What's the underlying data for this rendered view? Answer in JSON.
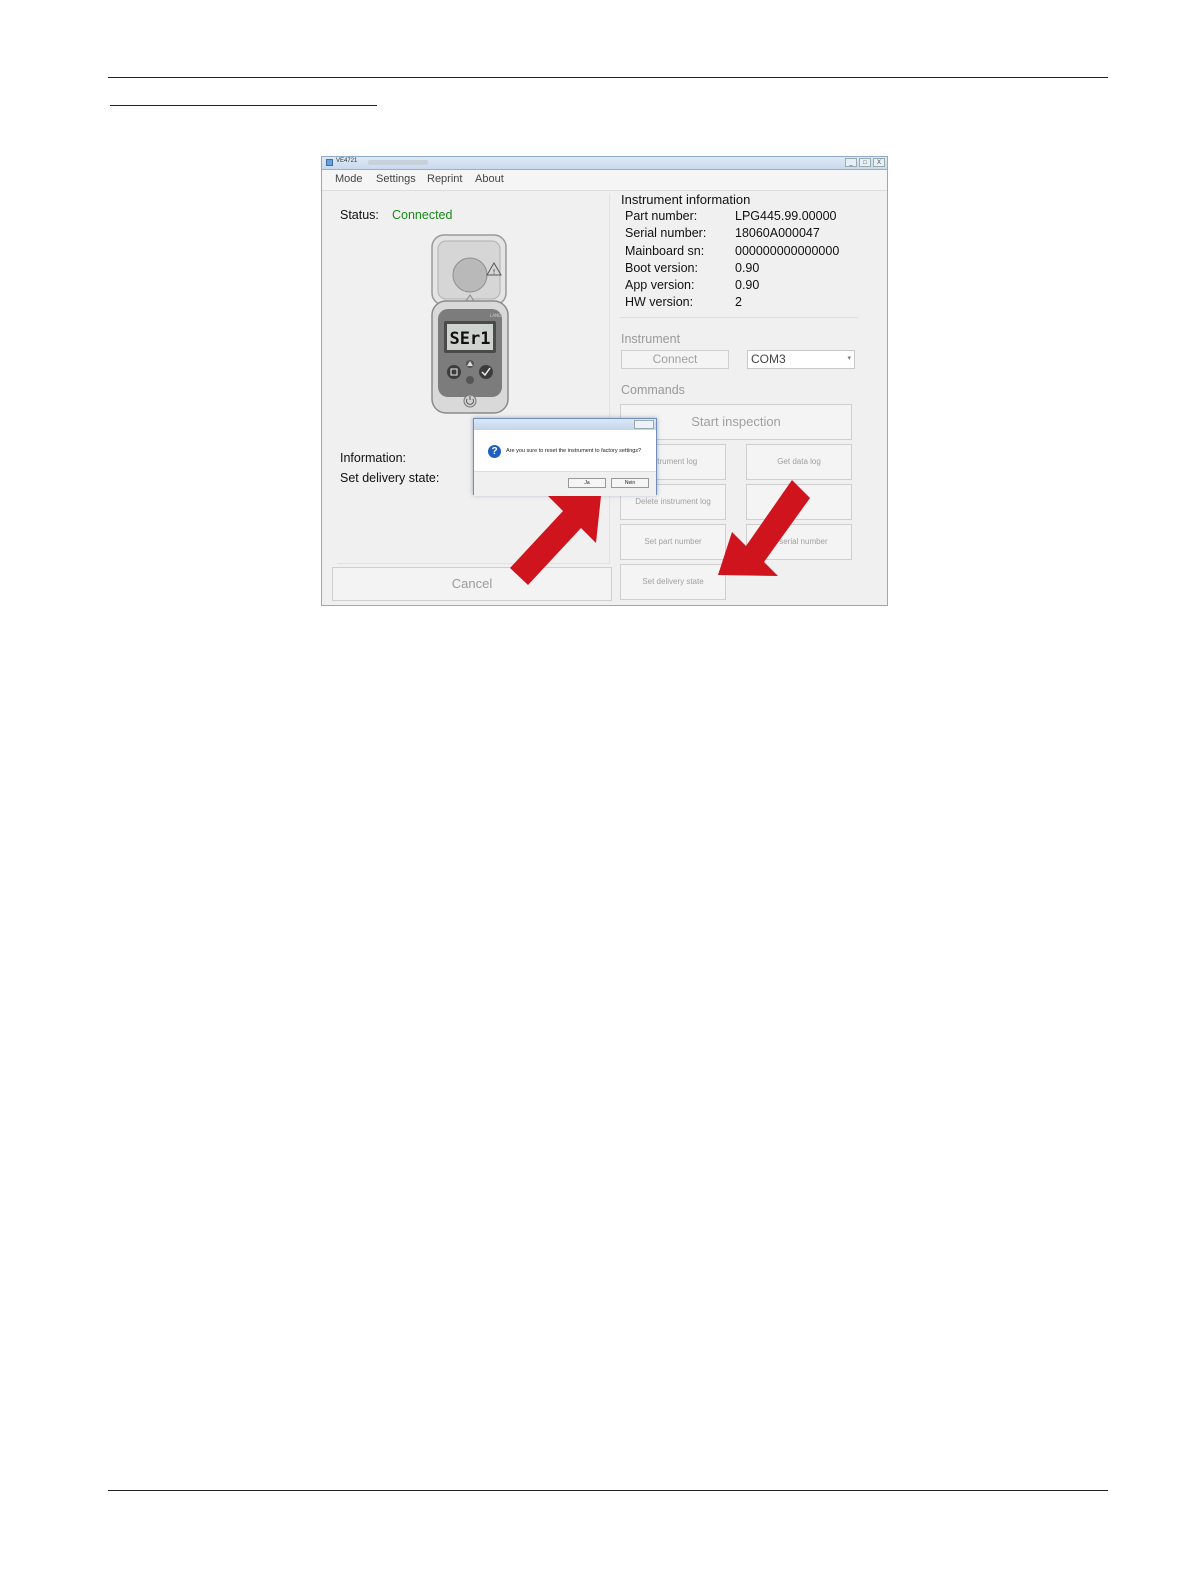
{
  "window": {
    "title": "VE4721",
    "buttons": [
      "_",
      "□",
      "X"
    ]
  },
  "menu": [
    {
      "label": "Mode"
    },
    {
      "label": "Settings"
    },
    {
      "label": "Reprint"
    },
    {
      "label": "About"
    }
  ],
  "left": {
    "status_label": "Status:",
    "status_value": "Connected",
    "information_label": "Information:",
    "delivery_label": "Set delivery state:",
    "cancel_label": "Cancel",
    "device_display": "SEr1"
  },
  "instrument_info": {
    "title": "Instrument information",
    "rows": [
      {
        "label": "Part number:",
        "value": "LPG445.99.00000"
      },
      {
        "label": "Serial number:",
        "value": "18060A000047"
      },
      {
        "label": "Mainboard sn:",
        "value": "000000000000000"
      },
      {
        "label": "Boot version:",
        "value": "0.90"
      },
      {
        "label": "App version:",
        "value": "0.90"
      },
      {
        "label": "HW version:",
        "value": "2"
      }
    ]
  },
  "instrument": {
    "title": "Instrument",
    "connect_label": "Connect",
    "port_value": "COM3"
  },
  "commands": {
    "title": "Commands",
    "start_inspection": "Start inspection",
    "get_instrument_log": "nstrument log",
    "get_data_log": "Get data log",
    "delete_instrument_log": "Delete instrument log",
    "delete_data_log": "e",
    "set_part_number": "Set part number",
    "set_serial_number": "et serial number",
    "set_delivery_state": "Set delivery state"
  },
  "dialog": {
    "message": "Are you sure to reset the instrument to factory settings?",
    "ok_label": "Ja",
    "no_label": "Nein"
  },
  "colors": {
    "status_connected": "#1a8a1a",
    "arrow": "#d0141e",
    "question_icon": "#1f5fbf"
  }
}
